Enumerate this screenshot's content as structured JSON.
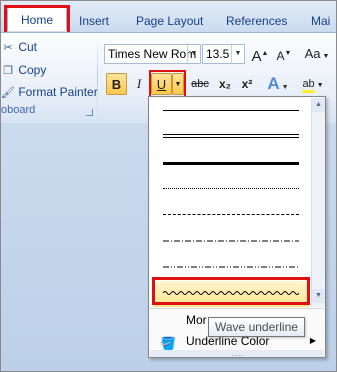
{
  "tabs": [
    "Home",
    "Insert",
    "Page Layout",
    "References",
    "Mai"
  ],
  "clipboard": {
    "items": [
      "Cut",
      "Copy",
      "Format Painter"
    ],
    "group_label": "oboard"
  },
  "font": {
    "name": "Times New Rom",
    "size": "13.5",
    "grow_label": "A",
    "shrink_label": "A",
    "change_case_label": "Aa"
  },
  "format_buttons": {
    "bold": "B",
    "italic": "I",
    "underline": "U",
    "strikethrough": "abc",
    "subscript": "x₂",
    "superscript": "x²",
    "text_effects": "A",
    "highlight": "ab"
  },
  "underline_menu": {
    "styles": [
      "single",
      "double",
      "thick",
      "dotted",
      "dashed",
      "dot-dash",
      "dot-dot-dash",
      "wave"
    ],
    "selected": "wave",
    "more_label": "More Underlines...",
    "more_visible": "Mor",
    "color_label": "Underline Color",
    "grip": "....."
  },
  "tooltip": "Wave underline",
  "colors": {
    "highlight_red": "#dd1111",
    "active_button": "#ffc84f"
  }
}
